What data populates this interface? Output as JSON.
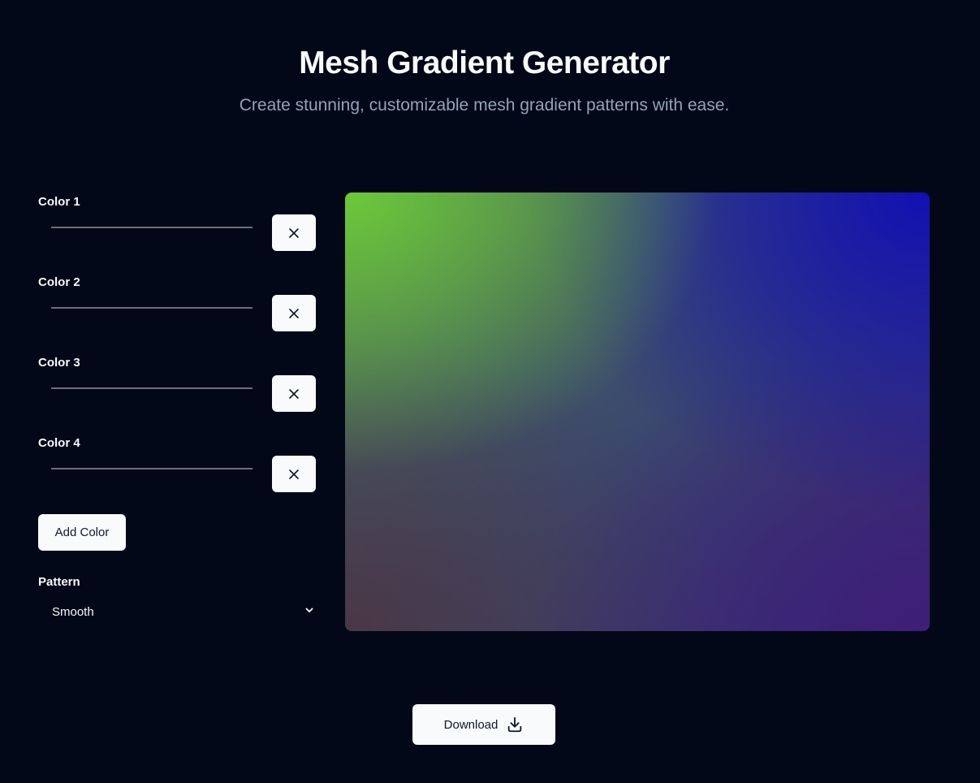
{
  "header": {
    "title": "Mesh Gradient Generator",
    "subtitle": "Create stunning, customizable mesh gradient patterns with ease."
  },
  "colors": [
    {
      "label": "Color 1"
    },
    {
      "label": "Color 2"
    },
    {
      "label": "Color 3"
    },
    {
      "label": "Color 4"
    }
  ],
  "add_color_label": "Add Color",
  "pattern": {
    "label": "Pattern",
    "selected": "Smooth"
  },
  "download_label": "Download",
  "icons": {
    "remove": "close-icon",
    "select": "chevron-down-icon",
    "download": "download-icon"
  },
  "theme": {
    "background": "#020817",
    "button_bg": "#f8fafc",
    "text_muted": "#94a3b8"
  }
}
